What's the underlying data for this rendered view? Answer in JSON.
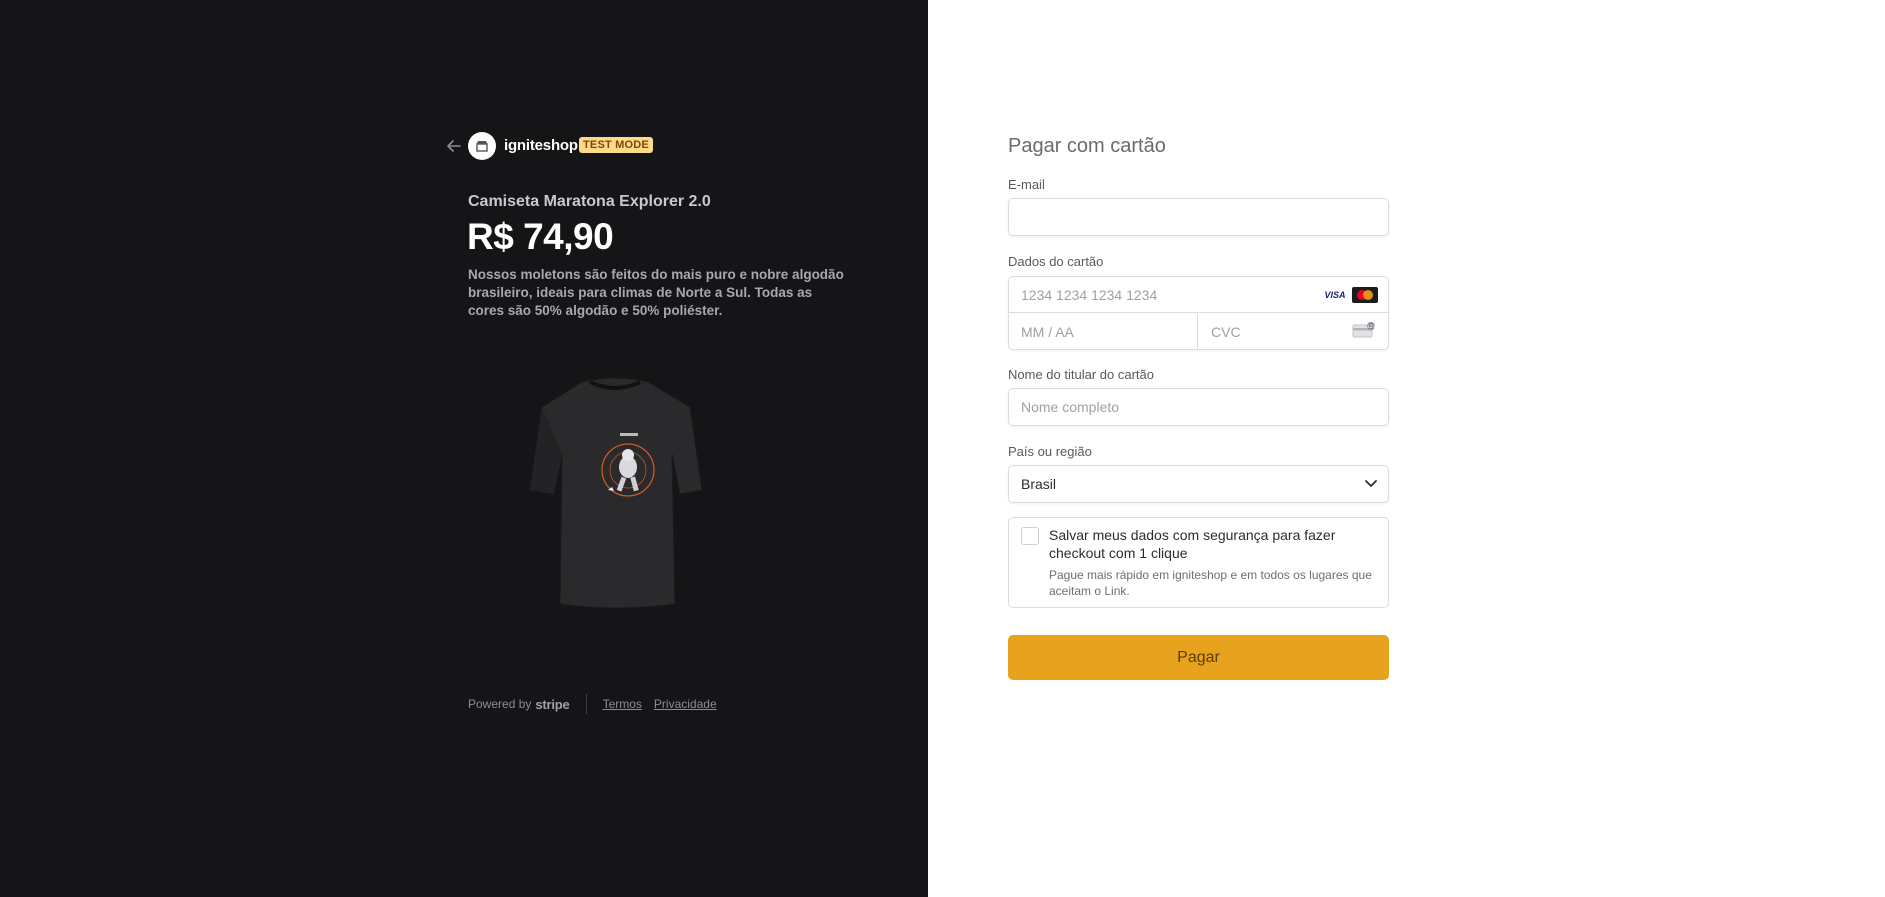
{
  "merchant": {
    "name": "igniteshop",
    "badge": "TEST MODE",
    "avatar_icon": "store-icon",
    "back_icon": "arrow-left-icon"
  },
  "product": {
    "name": "Camiseta Maratona Explorer 2.0",
    "price": "R$ 74,90",
    "description": "Nossos moletons são feitos do mais puro e nobre algodão brasileiro, ideais para climas de Norte a Sul. Todas as cores são 50% algodão e 50% poliéster.",
    "image_icon": "tshirt-image"
  },
  "footer": {
    "powered_by": "Powered by",
    "stripe": "stripe",
    "terms": "Termos",
    "privacy": "Privacidade"
  },
  "form": {
    "title": "Pagar com cartão",
    "email_label": "E-mail",
    "email_value": "",
    "card_label": "Dados do cartão",
    "card_number_placeholder": "1234 1234 1234 1234",
    "card_brands": [
      "VISA",
      "Mastercard"
    ],
    "expiry_placeholder": "MM / AA",
    "cvc_placeholder": "CVC",
    "cardholder_label": "Nome do titular do cartão",
    "cardholder_placeholder": "Nome completo",
    "country_label": "País ou região",
    "country_value": "Brasil",
    "save_title": "Salvar meus dados com segurança para fazer checkout com 1 clique",
    "save_sub": "Pague mais rápido em igniteshop e em todos os lugares que aceitam o Link.",
    "save_checked": false,
    "pay_label": "Pagar"
  },
  "colors": {
    "left_bg": "#151518",
    "accent": "#e8a31e",
    "badge_bg": "#ffd98a"
  }
}
